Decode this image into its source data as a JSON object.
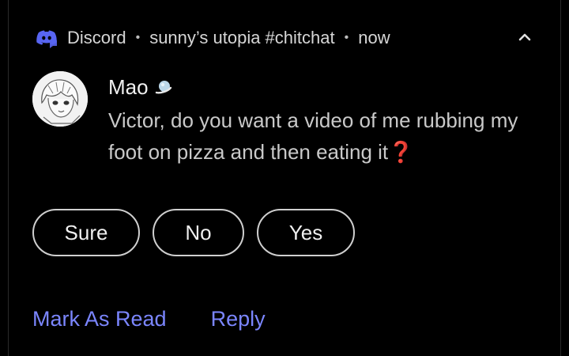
{
  "notification": {
    "app_name": "Discord",
    "channel": "sunny’s utopia #chitchat",
    "time": "now",
    "separator": "•",
    "sender": "Mao",
    "message_text": "Victor, do you want a video of me rubbing my foot on pizza and then eating it",
    "message_emoji": "❓",
    "icons": {
      "app": "discord-icon",
      "collapse": "chevron-up-icon",
      "sender_badge": "planet-icon",
      "avatar": "avatar-image"
    }
  },
  "quick_replies": [
    "Sure",
    "No",
    "Yes"
  ],
  "actions": {
    "mark_read": "Mark As Read",
    "reply": "Reply"
  },
  "colors": {
    "background": "#000000",
    "accent": "#7b86ff",
    "discord_blurple": "#5865f2",
    "question_mark": "#e0342b"
  }
}
